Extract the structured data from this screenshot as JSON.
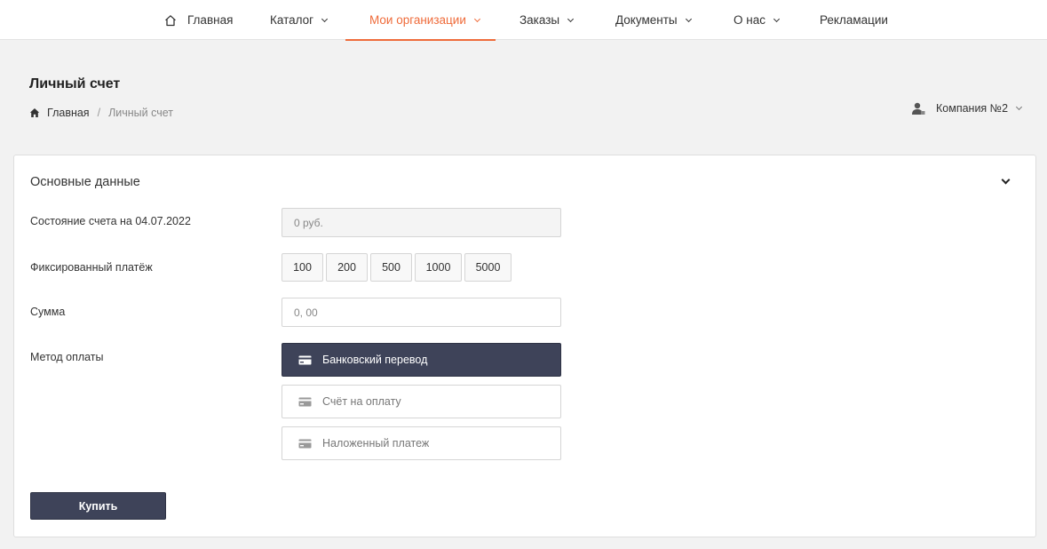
{
  "nav": {
    "items": [
      {
        "label": "Главная",
        "icon": "home-icon"
      },
      {
        "label": "Каталог",
        "has_dropdown": true
      },
      {
        "label": "Мои организации",
        "has_dropdown": true,
        "active": true
      },
      {
        "label": "Заказы",
        "has_dropdown": true
      },
      {
        "label": "Документы",
        "has_dropdown": true
      },
      {
        "label": "О нас",
        "has_dropdown": true
      },
      {
        "label": "Рекламации"
      }
    ]
  },
  "page": {
    "title": "Личный счет",
    "breadcrumb": {
      "home": "Главная",
      "separator": "/",
      "current": "Личный счет"
    }
  },
  "company_selector": {
    "label": "Компания №2",
    "icon": "user-icon"
  },
  "card": {
    "title": "Основные данные",
    "balance": {
      "label": "Состояние счета на 04.07.2022",
      "value": "0 руб."
    },
    "fixed_payment": {
      "label": "Фиксированный платёж",
      "amounts": [
        "100",
        "200",
        "500",
        "1000",
        "5000"
      ]
    },
    "sum": {
      "label": "Сумма",
      "placeholder": "0, 00"
    },
    "payment_method": {
      "label": "Метод оплаты",
      "options": [
        {
          "label": "Банковский перевод",
          "selected": true,
          "icon": "credit-card-icon"
        },
        {
          "label": "Счёт на оплату",
          "selected": false,
          "icon": "credit-card-icon"
        },
        {
          "label": "Наложенный платеж",
          "selected": false,
          "icon": "credit-card-icon"
        }
      ]
    },
    "buy_label": "Купить"
  },
  "colors": {
    "accent": "#ef6b3a",
    "primary": "#3e4359",
    "background": "#f2f2f2"
  }
}
